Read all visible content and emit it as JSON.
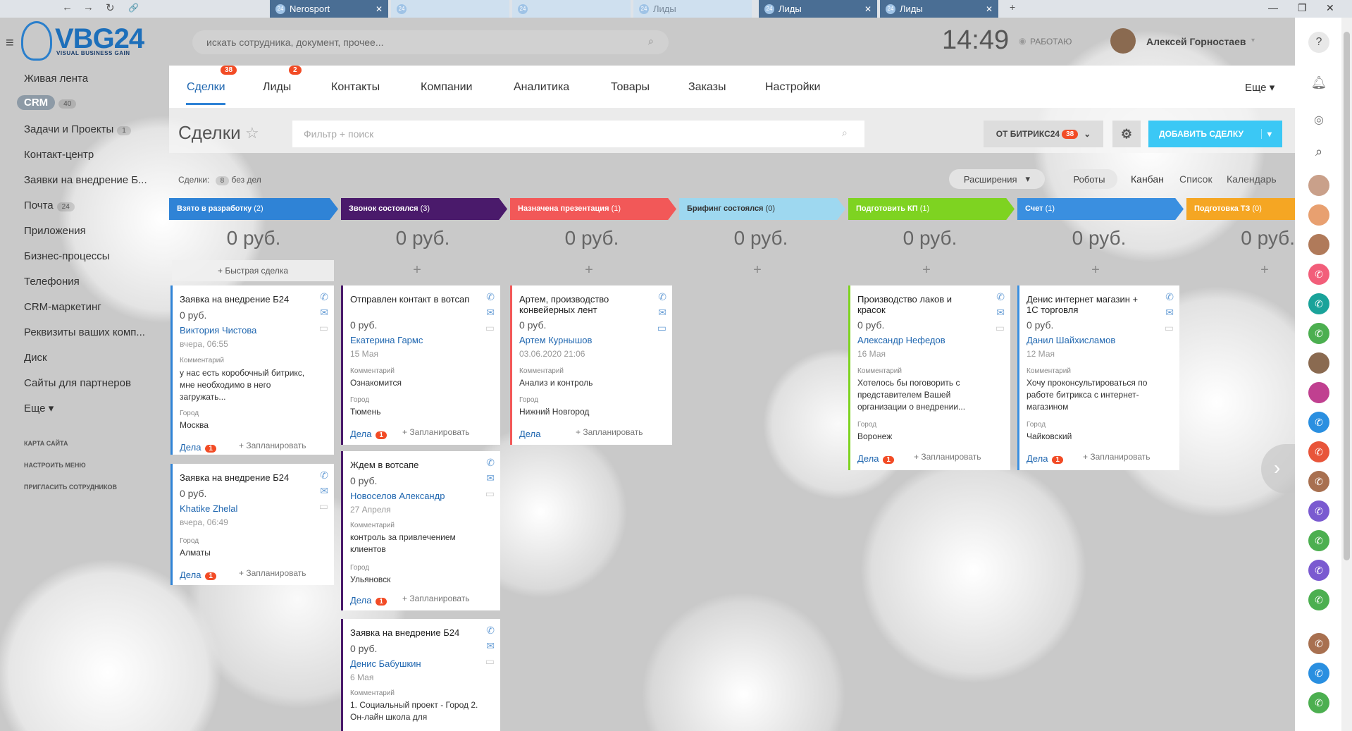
{
  "browser": {
    "nav": [
      "←",
      "→",
      "↻",
      "🔗"
    ],
    "tabs": [
      {
        "label": "Nerosport",
        "active": true
      },
      {
        "label": "",
        "active": false
      },
      {
        "label": "",
        "active": false
      },
      {
        "label": "Лиды",
        "active": false
      },
      {
        "label": "Лиды",
        "active": true
      },
      {
        "label": "Лиды",
        "active": true
      }
    ],
    "new_tab": "+",
    "win": [
      "—",
      "❐",
      "✕"
    ]
  },
  "header": {
    "logo": "VBG24",
    "logo_sub": "VISUAL BUSINESS GAIN",
    "search_placeholder": "искать сотрудника, документ, прочее...",
    "clock": "14:49",
    "status": "РАБОТАЮ",
    "user": "Алексей Горностаев"
  },
  "left_menu": {
    "items": [
      {
        "label": "Живая лента",
        "count": ""
      },
      {
        "label": "CRM",
        "count": "40"
      },
      {
        "label": "Задачи и Проекты",
        "count": "1"
      },
      {
        "label": "Контакт-центр",
        "count": ""
      },
      {
        "label": "Заявки на внедрение Б...",
        "count": ""
      },
      {
        "label": "Почта",
        "count": "24"
      },
      {
        "label": "Приложения",
        "count": ""
      },
      {
        "label": "Бизнес-процессы",
        "count": ""
      },
      {
        "label": "Телефония",
        "count": ""
      },
      {
        "label": "CRM-маркетинг",
        "count": ""
      },
      {
        "label": "Реквизиты ваших комп...",
        "count": ""
      },
      {
        "label": "Диск",
        "count": ""
      },
      {
        "label": "Сайты для партнеров",
        "count": ""
      },
      {
        "label": "Еще ▾",
        "count": ""
      }
    ],
    "links": [
      "КАРТА САЙТА",
      "НАСТРОИТЬ МЕНЮ",
      "ПРИГЛАСИТЬ СОТРУДНИКОВ"
    ]
  },
  "tabs": [
    {
      "label": "Сделки",
      "badge": "38"
    },
    {
      "label": "Лиды",
      "badge": "2"
    },
    {
      "label": "Контакты",
      "badge": ""
    },
    {
      "label": "Компании",
      "badge": ""
    },
    {
      "label": "Аналитика",
      "badge": ""
    },
    {
      "label": "Товары",
      "badge": ""
    },
    {
      "label": "Заказы",
      "badge": ""
    },
    {
      "label": "Настройки",
      "badge": ""
    },
    {
      "label": "Еще ▾",
      "badge": ""
    }
  ],
  "toolbar": {
    "title": "Сделки",
    "filter_placeholder": "Фильтр + поиск",
    "source_label": "ОТ БИТРИКС24",
    "source_badge": "38",
    "add_label": "ДОБАВИТЬ СДЕЛКУ"
  },
  "subbar": {
    "deals_label": "Сделки:",
    "deals_count": "8",
    "no_deals": "без дел",
    "extensions": "Расширения",
    "robots": "Роботы",
    "view_kanban": "Канбан",
    "view_list": "Список",
    "view_calendar": "Календарь"
  },
  "columns": [
    {
      "title": "Взято в разработку",
      "count": "(2)",
      "color": "#2f83d6",
      "sum": "0 руб.",
      "quick": "Быстрая сделка"
    },
    {
      "title": "Звонок состоялся",
      "count": "(3)",
      "color": "#4a1a6b",
      "sum": "0 руб.",
      "quick": ""
    },
    {
      "title": "Назначена презентация",
      "count": "(1)",
      "color": "#f25858",
      "sum": "0 руб.",
      "quick": ""
    },
    {
      "title": "Брифинг состоялся",
      "count": "(0)",
      "color": "#9ed8f0",
      "sum": "0 руб.",
      "quick": ""
    },
    {
      "title": "Подготовить КП",
      "count": "(1)",
      "color": "#7ed321",
      "sum": "0 руб.",
      "quick": ""
    },
    {
      "title": "Счет",
      "count": "(1)",
      "color": "#3a8fe0",
      "sum": "0 руб.",
      "quick": ""
    },
    {
      "title": "Подготовка ТЗ",
      "count": "(0)",
      "color": "#f5a623",
      "sum": "0 руб.",
      "quick": ""
    }
  ],
  "cards": [
    {
      "title": "Заявка на внедрение Б24",
      "price": "0 руб.",
      "name": "Виктория Чистова",
      "date": "вчера, 06:55",
      "l1": "Комментарий",
      "v1": "у нас есть коробочный битрикс, мне необходимо в него загружать...",
      "l2": "Город",
      "v2": "Москва",
      "deals": "Дела",
      "dbadge": "1",
      "plan": "+ Запланировать"
    },
    {
      "title": "Заявка на внедрение Б24",
      "price": "0 руб.",
      "name": "Khatike Zhelal",
      "date": "вчера, 06:49",
      "l1": "Город",
      "v1": "Алматы",
      "l2": "",
      "v2": "",
      "deals": "Дела",
      "dbadge": "1",
      "plan": "+ Запланировать"
    },
    {
      "title": "Отправлен контакт в вотсап",
      "price": "0 руб.",
      "name": "Екатерина Гармс",
      "date": "15 Мая",
      "l1": "Комментарий",
      "v1": "Ознакомится",
      "l2": "Город",
      "v2": "Тюмень",
      "deals": "Дела",
      "dbadge": "1",
      "plan": "+ Запланировать"
    },
    {
      "title": "Ждем в вотсапе",
      "price": "0 руб.",
      "name": "Новоселов Александр",
      "date": "27 Апреля",
      "l1": "Комментарий",
      "v1": "контроль за привлечением клиентов",
      "l2": "Город",
      "v2": "Ульяновск",
      "deals": "Дела",
      "dbadge": "1",
      "plan": "+ Запланировать"
    },
    {
      "title": "Заявка на внедрение Б24",
      "price": "0 руб.",
      "name": "Денис Бабушкин",
      "date": "6 Мая",
      "l1": "Комментарий",
      "v1": "1. Социальный проект - Город 2. Он-лайн школа для",
      "l2": "",
      "v2": "",
      "deals": "",
      "dbadge": "",
      "plan": ""
    },
    {
      "title": "Артем, производство конвейерных лент",
      "price": "0 руб.",
      "name": "Артем Курнышов",
      "date": "03.06.2020 21:06",
      "l1": "Комментарий",
      "v1": "Анализ и контроль",
      "l2": "Город",
      "v2": "Нижний Новгород",
      "deals": "Дела",
      "dbadge": "",
      "plan": "+ Запланировать"
    },
    {
      "title": "Производство лаков и красок",
      "price": "0 руб.",
      "name": "Александр Нефедов",
      "date": "16 Мая",
      "l1": "Комментарий",
      "v1": "Хотелось бы поговорить с представителем Вашей организации о внедрении...",
      "l2": "Город",
      "v2": "Воронеж",
      "deals": "Дела",
      "dbadge": "1",
      "plan": "+ Запланировать"
    },
    {
      "title": "Денис интернет магазин + 1С торговля",
      "price": "0 руб.",
      "name": "Данил Шайхисламов",
      "date": "12 Мая",
      "l1": "Комментарий",
      "v1": "Хочу проконсультироваться по работе битрикса с интернет-магазином",
      "l2": "Город",
      "v2": "Чайковский",
      "deals": "Дела",
      "dbadge": "1",
      "plan": "+ Запланировать"
    }
  ],
  "rightbar": {
    "colors": [
      "#c9a08a",
      "#e8a070",
      "#b07a5a",
      "#f25e7a",
      "#1aa39a",
      "#4caf50",
      "#8a6a50",
      "#c04090",
      "#2a8fe0",
      "#e8553a",
      "#a87050",
      "#7a5ad0",
      "#4caf50",
      "#7a5ad0",
      "#4caf50",
      "#a87050",
      "#2a8fe0",
      "#4caf50"
    ]
  }
}
